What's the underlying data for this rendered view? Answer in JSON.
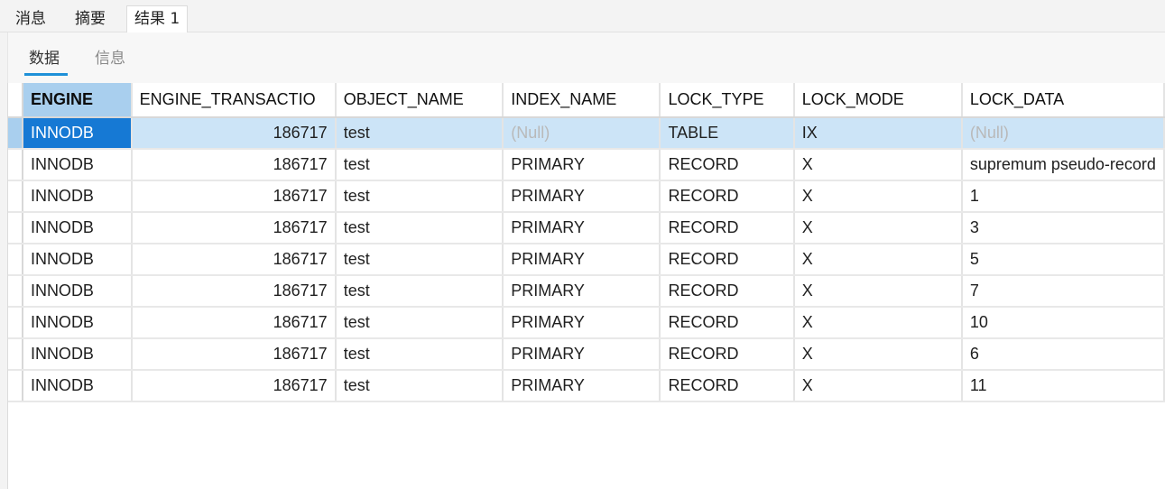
{
  "tabs": [
    {
      "label": "消息"
    },
    {
      "label": "摘要"
    },
    {
      "label": "结果 1"
    }
  ],
  "subtabs": [
    {
      "label": "数据"
    },
    {
      "label": "信息"
    }
  ],
  "columns": [
    "ENGINE",
    "ENGINE_TRANSACTIO",
    "OBJECT_NAME",
    "INDEX_NAME",
    "LOCK_TYPE",
    "LOCK_MODE",
    "LOCK_DATA"
  ],
  "rows": [
    [
      "INNODB",
      "186717",
      "test",
      "(Null)",
      "TABLE",
      "IX",
      "(Null)"
    ],
    [
      "INNODB",
      "186717",
      "test",
      "PRIMARY",
      "RECORD",
      "X",
      "supremum pseudo-record"
    ],
    [
      "INNODB",
      "186717",
      "test",
      "PRIMARY",
      "RECORD",
      "X",
      "1"
    ],
    [
      "INNODB",
      "186717",
      "test",
      "PRIMARY",
      "RECORD",
      "X",
      "3"
    ],
    [
      "INNODB",
      "186717",
      "test",
      "PRIMARY",
      "RECORD",
      "X",
      "5"
    ],
    [
      "INNODB",
      "186717",
      "test",
      "PRIMARY",
      "RECORD",
      "X",
      "7"
    ],
    [
      "INNODB",
      "186717",
      "test",
      "PRIMARY",
      "RECORD",
      "X",
      "10"
    ],
    [
      "INNODB",
      "186717",
      "test",
      "PRIMARY",
      "RECORD",
      "X",
      "6"
    ],
    [
      "INNODB",
      "186717",
      "test",
      "PRIMARY",
      "RECORD",
      "X",
      "11"
    ]
  ],
  "selection": {
    "row": 0,
    "column": 0
  },
  "colors": {
    "selected_row": "#cce4f7",
    "current_cell": "#1679d4",
    "header_selected": "#a9cfee",
    "null_text": "#b9b9b9",
    "subtab_underline": "#1e90d8"
  }
}
